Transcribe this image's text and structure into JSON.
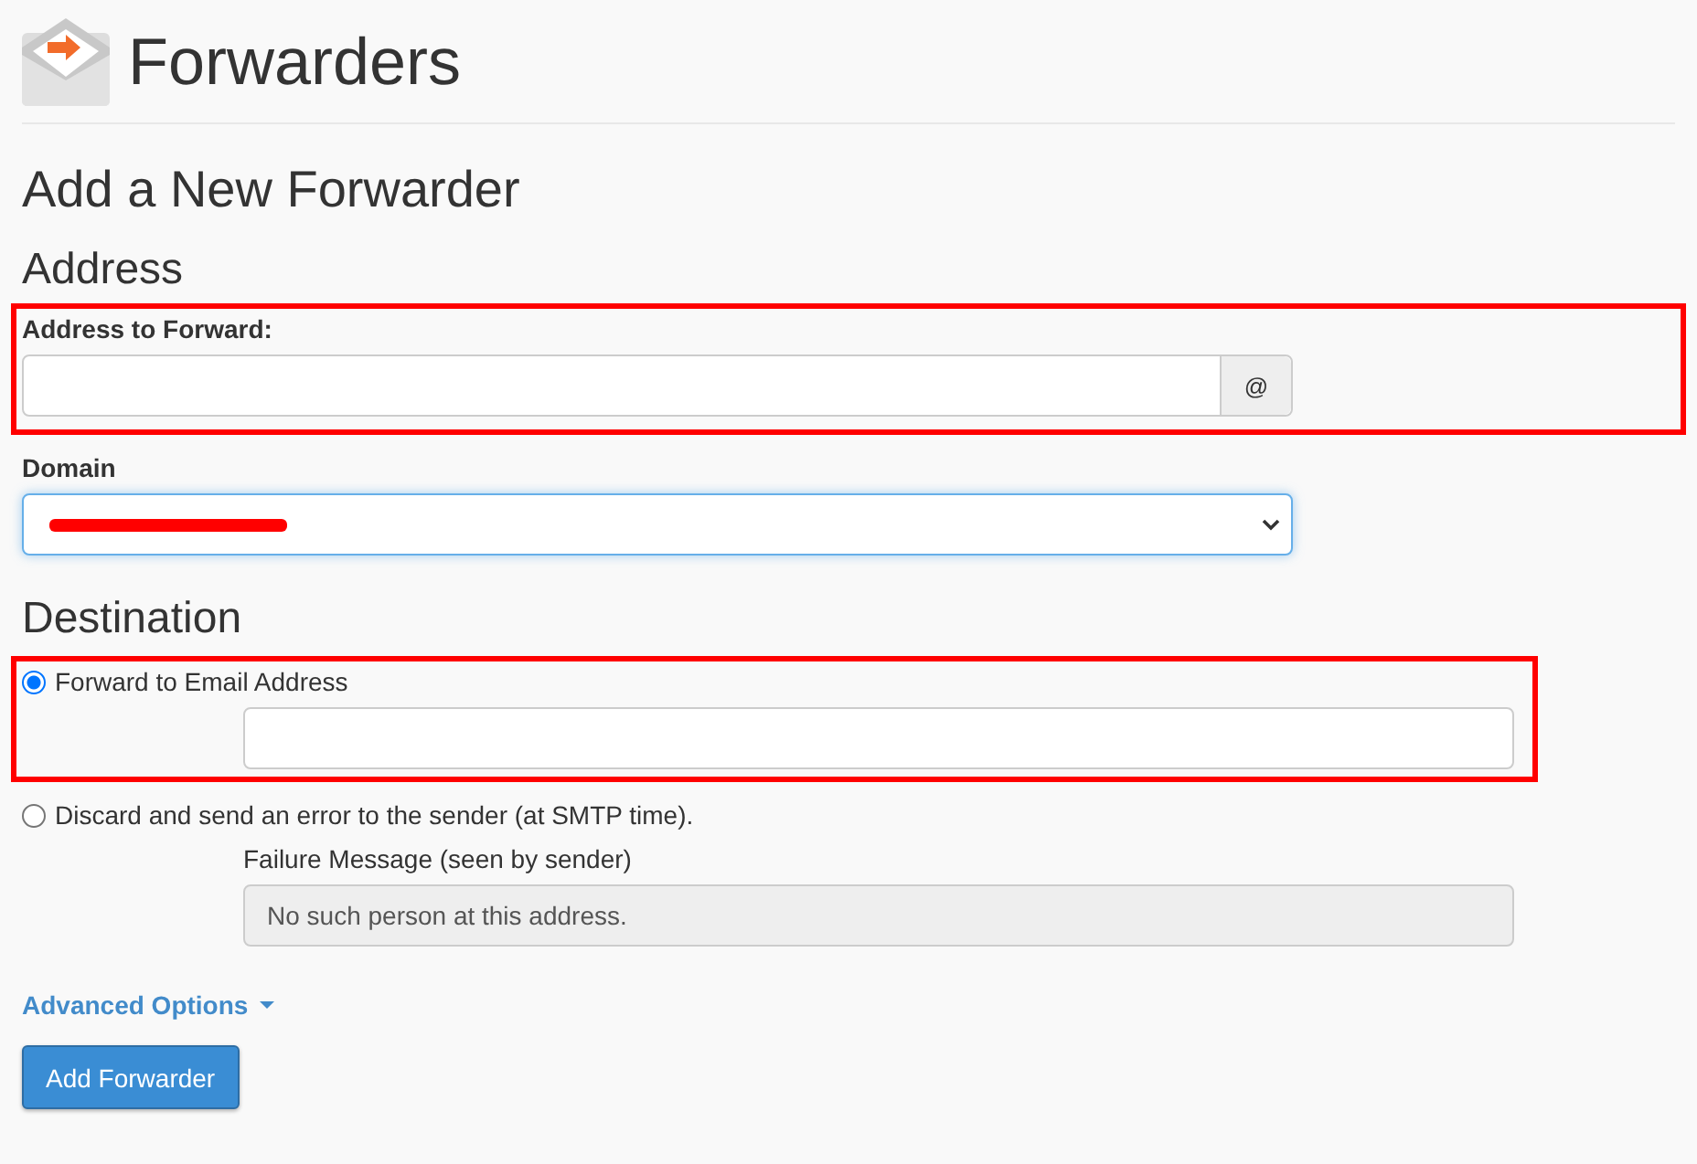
{
  "header": {
    "title": "Forwarders"
  },
  "form": {
    "title": "Add a New Forwarder",
    "address": {
      "heading": "Address",
      "highlighted": true,
      "label": "Address to Forward:",
      "addon": "@"
    },
    "domain": {
      "label": "Domain",
      "redacted": true
    },
    "destination": {
      "heading": "Destination",
      "options": [
        {
          "kind": "email",
          "label": "Forward to Email Address",
          "selected": true,
          "highlighted": true
        },
        {
          "kind": "discard",
          "label": "Discard and send an error to the sender (at SMTP time).",
          "selected": false,
          "highlighted": false,
          "field_label": "Failure Message (seen by sender)",
          "value": "No such person at this address.",
          "disabled": true
        }
      ]
    },
    "advanced_options": "Advanced Options",
    "submit": "Add Forwarder"
  }
}
